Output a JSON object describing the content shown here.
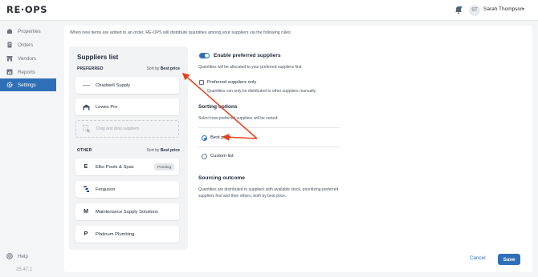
{
  "app": {
    "logo": "RE·OPS"
  },
  "header": {
    "user_initials": "ST",
    "user_name": "Sarah Thompson"
  },
  "sidebar": {
    "items": [
      {
        "label": "Properties",
        "icon": "building-icon"
      },
      {
        "label": "Orders",
        "icon": "document-icon"
      },
      {
        "label": "Vendors",
        "icon": "store-icon"
      },
      {
        "label": "Reports",
        "icon": "chart-icon"
      },
      {
        "label": "Settings",
        "icon": "gear-icon",
        "active": true
      }
    ],
    "help_label": "Help",
    "version": "25.47.1"
  },
  "main": {
    "intro": "When new items are added to an order, RE-OPS will distribute quantities among your suppliers via the following rules:"
  },
  "suppliers": {
    "title": "Suppliers list",
    "preferred_label": "PREFERRED",
    "other_label": "OTHER",
    "sort_prefix": "Sort by",
    "sort_value": "Best price",
    "preferred": [
      {
        "name": "Chadwell Supply",
        "icon": "line-icon"
      },
      {
        "name": "Lowes Pro",
        "icon": "warehouse-icon"
      }
    ],
    "drop_hint": "Drag and drop suppliers",
    "other": [
      {
        "name": "Elko Pools & Spas",
        "icon": "E",
        "badge": "Pending"
      },
      {
        "name": "Ferguson",
        "icon": "ferguson-logo-icon"
      },
      {
        "name": "Maintenance Supply Solutions",
        "icon": "M"
      },
      {
        "name": "Platinum Plumbing",
        "icon": "P"
      }
    ]
  },
  "settings": {
    "enable_title": "Enable preferred suppliers",
    "enable_desc": "Quantities will be allocated to your preferred suppliers first.",
    "enable_on": true,
    "preferred_only_label": "Preferred suppliers only",
    "preferred_only_desc": "Quantities can only be distributed to other suppliers manually.",
    "sorting_title": "Sorting options",
    "sorting_desc": "Select how preferred suppliers will be sorted:",
    "options": [
      {
        "label": "Best price",
        "selected": true
      },
      {
        "label": "Custom list",
        "selected": false
      }
    ],
    "outcome_title": "Sourcing outcome",
    "outcome_desc": "Quantities are distributed to suppliers with available stock, prioritizing preferred suppliers first and then others, both by best price."
  },
  "actions": {
    "cancel": "Cancel",
    "save": "Save"
  },
  "colors": {
    "accent": "#2f6fb7",
    "annotation_arrow": "#e8401c"
  }
}
